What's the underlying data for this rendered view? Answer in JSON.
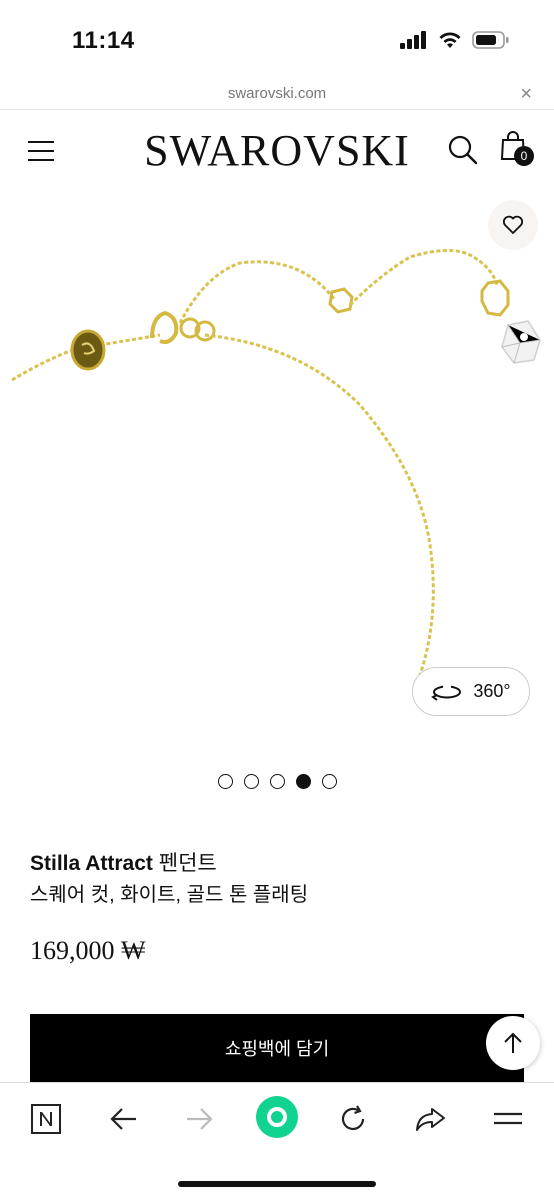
{
  "status_bar": {
    "time": "11:14",
    "icons": [
      "cellular-signal-icon",
      "wifi-icon",
      "battery-icon"
    ]
  },
  "url_bar": {
    "domain": "swarovski.com",
    "close_symbol": "×"
  },
  "header": {
    "brand": "SWAROVSKI",
    "bag_count": "0",
    "icons": [
      "hamburger-menu-icon",
      "search-icon",
      "shopping-bag-icon"
    ]
  },
  "gallery": {
    "view360_label": "360°",
    "dots": 5,
    "active_dot_index": 3,
    "icons": [
      "heart-icon",
      "rotate-360-icon"
    ]
  },
  "product": {
    "name_latin": "Stilla Attract",
    "name_korean": " 펜던트",
    "description": "스퀘어 컷, 화이트, 골드 톤 플래팅",
    "price": "169,000 ₩"
  },
  "actions": {
    "add_to_bag": "쇼핑백에 담기",
    "scroll_top_icon": "arrow-up-icon"
  },
  "browser_toolbar": {
    "icons": [
      "naver-n-icon",
      "back-arrow-icon",
      "forward-arrow-icon",
      "green-home-icon",
      "reload-icon",
      "share-icon",
      "menu-icon"
    ]
  },
  "colors": {
    "accent_green": "#10d38f",
    "gold_chain": "#d9c24e",
    "text": "#111111"
  }
}
